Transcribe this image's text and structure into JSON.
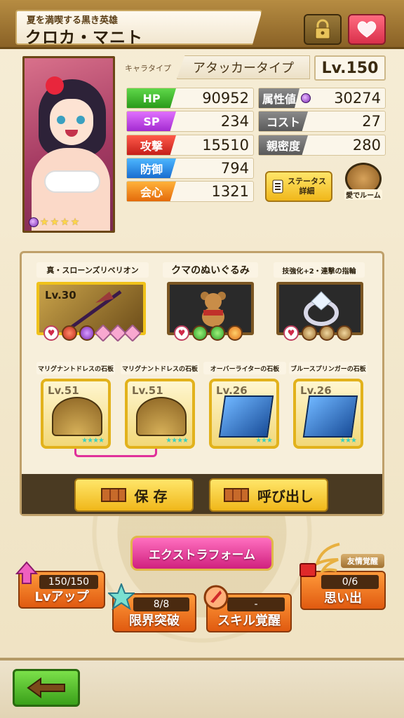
{
  "header": {
    "subtitle": "夏を満喫する黒き英雄",
    "title": "クロカ・マニト"
  },
  "character": {
    "type_label": "キャラタイプ",
    "type_value": "アタッカータイプ",
    "level": "Lv.150",
    "rarity_stars": 4
  },
  "stats": [
    {
      "label": "HP",
      "value": "90952"
    },
    {
      "label": "SP",
      "value": "234"
    },
    {
      "label": "攻撃",
      "value": "15510"
    },
    {
      "label": "防御",
      "value": "794"
    },
    {
      "label": "会心",
      "value": "1321"
    }
  ],
  "stats_right": [
    {
      "label": "属性値",
      "value": "30274"
    },
    {
      "label": "コスト",
      "value": "27"
    },
    {
      "label": "親密度",
      "value": "280"
    }
  ],
  "buttons": {
    "status_detail_line1": "ステータス",
    "status_detail_line2": "詳細",
    "room": "愛でルーム",
    "save": "保 存",
    "load": "呼び出し",
    "extra_form": "エクストラフォーム",
    "back_icon": "arrow-left-icon"
  },
  "equipment": [
    {
      "name": "真・スローンズリベリオン",
      "level": "Lv.30"
    },
    {
      "name": "クマのぬいぐるみ",
      "level": ""
    },
    {
      "name": "技強化+2・連撃の指輪",
      "level": ""
    }
  ],
  "stones": [
    {
      "name": "マリグナントドレスの石板",
      "level": "Lv.51",
      "stars": "★★★★"
    },
    {
      "name": "マリグナントドレスの石板",
      "level": "Lv.51",
      "stars": "★★★★"
    },
    {
      "name": "オーバーライターの石板",
      "level": "Lv.26",
      "stars": "★★★"
    },
    {
      "name": "ブルースプリンガーの石板",
      "level": "Lv.26",
      "stars": "★★★"
    }
  ],
  "actions": {
    "lvup": {
      "count": "150/150",
      "label": "Lvアップ"
    },
    "limit": {
      "count": "8/8",
      "label": "限界突破"
    },
    "skill": {
      "count": "-",
      "label": "スキル覚醒"
    },
    "memory": {
      "badge": "友情覚醒",
      "count": "0/6",
      "label": "思い出"
    }
  },
  "colors": {
    "hp": "#2a9a1a",
    "sp": "#a32bd0",
    "atk": "#c41f1a",
    "def": "#1a6dd0",
    "crit": "#e46a0a",
    "gold": "#f0b71a",
    "pink": "#d0207e"
  }
}
